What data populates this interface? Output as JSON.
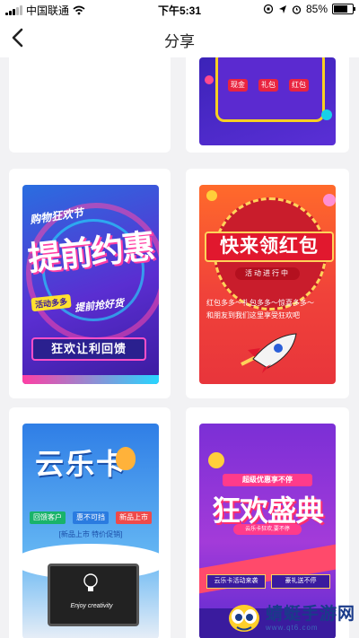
{
  "status_bar": {
    "carrier": "中国联通",
    "time": "下午5:31",
    "battery": "85%",
    "battery_level": 0.85
  },
  "nav": {
    "title": "分享"
  },
  "posters": [
    {
      "id": "p2",
      "buttons": [
        "现金",
        "礼包",
        "红包"
      ]
    },
    {
      "id": "p3",
      "tagline": "购物狂欢节",
      "headline": "提前约惠",
      "sub1": "活动多多",
      "sub2": "提前抢好货",
      "banner": "狂欢让利回馈"
    },
    {
      "id": "p4",
      "headline": "快来领红包",
      "ribbon": "活动进行中",
      "line1": "红包多多～礼包多多～惊喜多多～",
      "line2": "和朋友到我们这里享受狂欢吧"
    },
    {
      "id": "p5",
      "headline": "云乐卡",
      "tags": [
        "回馈客户",
        "惠不可挡",
        "新品上市"
      ],
      "promo": "[新品上市 特价促销]",
      "screen_text": "Enjoy creativity"
    },
    {
      "id": "p6",
      "top_banner": "超级优惠享不停",
      "headline": "狂欢盛典",
      "badge": "云乐卡狂欢,要不停",
      "footer1": "云乐卡活动来袭",
      "footer2": "豪礼送不停"
    }
  ],
  "watermark": {
    "name": "蜻蜓手游网",
    "url": "www.qt6.com"
  }
}
